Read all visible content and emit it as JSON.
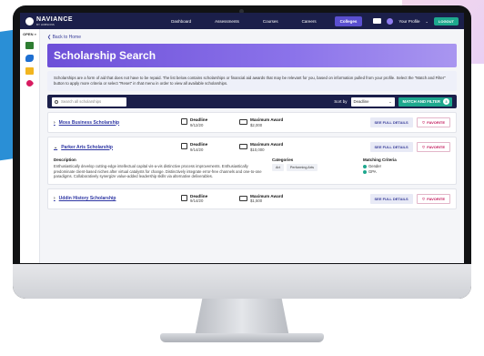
{
  "colors": {
    "nav_bg": "#1b1f4a",
    "accent_purple": "#6d4fd8",
    "accent_green": "#1ea88e",
    "link_blue": "#2e36a3",
    "favorite_pink": "#c2185b"
  },
  "topnav": {
    "brand": "NAVIANCE",
    "brand_sub": "BY HOBSONS",
    "links": [
      "Dashboard",
      "Assessments",
      "Courses",
      "Careers",
      "Colleges"
    ],
    "active_link": "Colleges",
    "profile_label": "Your Profile",
    "logout_label": "LOGOUT"
  },
  "sidebar": {
    "toggle_label": "OPEN »"
  },
  "page": {
    "back_label": "❮ Back to Home",
    "title": "Scholarship Search",
    "intro": "Scholarships are a form of aid that does not have to be repaid. The list below contains scholarships or financial aid awards that may be relevant for you, based on information pulled from your profile. Select the \"Match and Filter\" button to apply more criteria or select \"Reset\" in that menu in order to view all available scholarships."
  },
  "search": {
    "placeholder": "Search all scholarships",
    "sort_label": "Sort by",
    "sort_value": "Deadline",
    "match_button": "MATCH AND FILTER",
    "match_count": "3"
  },
  "labels": {
    "deadline": "Deadline",
    "max_award": "Maximum Award",
    "see_details": "SEE FULL DETAILS",
    "favorite": "FAVORITE",
    "description": "Description",
    "categories": "Categories",
    "matching_criteria": "Matching Criteria"
  },
  "scholarships": [
    {
      "name": "Moss Business Scholarship",
      "arrow": "›",
      "deadline": "9/12/20",
      "award": "$2,000"
    },
    {
      "name": "Parker Arts Scholarship",
      "arrow": "⌄",
      "deadline": "9/14/20",
      "award": "$10,000",
      "description": "Enthusiastically develop cutting-edge intellectual capital vis-a-vis distinctive process improvements. Enthusiastically predominate client-based niches after virtual catalysts for change. Distinctively integrate error-free channels and one-to-one paradigms. Collaboratively synergize value-added leadership skills via alternative deliverables.",
      "categories": [
        "Art",
        "Performing Arts"
      ],
      "criteria": [
        "Gender",
        "GPA"
      ]
    },
    {
      "name": "Uddin History Scholarship",
      "arrow": "›",
      "deadline": "9/14/20",
      "award": "$1,500"
    }
  ]
}
